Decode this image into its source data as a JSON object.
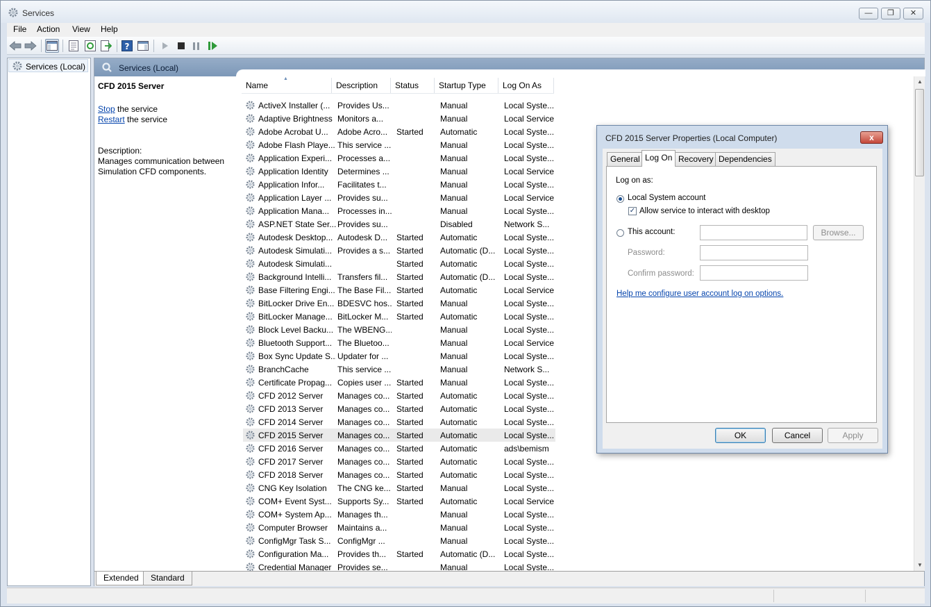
{
  "window": {
    "title": "Services"
  },
  "menu": [
    "File",
    "Action",
    "View",
    "Help"
  ],
  "tree": {
    "root_label": "Services (Local)"
  },
  "main": {
    "header": "Services (Local)",
    "selected_service": "CFD 2015 Server",
    "stop_link": "Stop",
    "stop_suffix": " the service",
    "restart_link": "Restart",
    "restart_suffix": " the service",
    "description_label": "Description:",
    "description_line1": "Manages communication between",
    "description_line2": "Simulation CFD components."
  },
  "columns": [
    "Name",
    "Description",
    "Status",
    "Startup Type",
    "Log On As"
  ],
  "rows": [
    [
      "ActiveX Installer (...",
      "Provides Us...",
      "",
      "Manual",
      "Local Syste..."
    ],
    [
      "Adaptive Brightness",
      "Monitors a...",
      "",
      "Manual",
      "Local Service"
    ],
    [
      "Adobe Acrobat U...",
      "Adobe Acro...",
      "Started",
      "Automatic",
      "Local Syste..."
    ],
    [
      "Adobe Flash Playe...",
      "This service ...",
      "",
      "Manual",
      "Local Syste..."
    ],
    [
      "Application Experi...",
      "Processes a...",
      "",
      "Manual",
      "Local Syste..."
    ],
    [
      "Application Identity",
      "Determines ...",
      "",
      "Manual",
      "Local Service"
    ],
    [
      "Application Infor...",
      "Facilitates t...",
      "",
      "Manual",
      "Local Syste..."
    ],
    [
      "Application Layer ...",
      "Provides su...",
      "",
      "Manual",
      "Local Service"
    ],
    [
      "Application Mana...",
      "Processes in...",
      "",
      "Manual",
      "Local Syste..."
    ],
    [
      "ASP.NET State Ser...",
      "Provides su...",
      "",
      "Disabled",
      "Network S..."
    ],
    [
      "Autodesk Desktop...",
      "Autodesk D...",
      "Started",
      "Automatic",
      "Local Syste..."
    ],
    [
      "Autodesk Simulati...",
      "Provides a s...",
      "Started",
      "Automatic (D...",
      "Local Syste..."
    ],
    [
      "Autodesk Simulati...",
      "",
      "Started",
      "Automatic",
      "Local Syste..."
    ],
    [
      "Background Intelli...",
      "Transfers fil...",
      "Started",
      "Automatic (D...",
      "Local Syste..."
    ],
    [
      "Base Filtering Engi...",
      "The Base Fil...",
      "Started",
      "Automatic",
      "Local Service"
    ],
    [
      "BitLocker Drive En...",
      "BDESVC hos...",
      "Started",
      "Manual",
      "Local Syste..."
    ],
    [
      "BitLocker Manage...",
      "BitLocker M...",
      "Started",
      "Automatic",
      "Local Syste..."
    ],
    [
      "Block Level Backu...",
      "The WBENG...",
      "",
      "Manual",
      "Local Syste..."
    ],
    [
      "Bluetooth Support...",
      "The Bluetoo...",
      "",
      "Manual",
      "Local Service"
    ],
    [
      "Box Sync Update S...",
      "Updater for ...",
      "",
      "Manual",
      "Local Syste..."
    ],
    [
      "BranchCache",
      "This service ...",
      "",
      "Manual",
      "Network S..."
    ],
    [
      "Certificate Propag...",
      "Copies user ...",
      "Started",
      "Manual",
      "Local Syste..."
    ],
    [
      "CFD 2012 Server",
      "Manages co...",
      "Started",
      "Automatic",
      "Local Syste..."
    ],
    [
      "CFD 2013 Server",
      "Manages co...",
      "Started",
      "Automatic",
      "Local Syste..."
    ],
    [
      "CFD 2014 Server",
      "Manages co...",
      "Started",
      "Automatic",
      "Local Syste..."
    ],
    [
      "CFD 2015 Server",
      "Manages co...",
      "Started",
      "Automatic",
      "Local Syste..."
    ],
    [
      "CFD 2016 Server",
      "Manages co...",
      "Started",
      "Automatic",
      "ads\\bemism"
    ],
    [
      "CFD 2017 Server",
      "Manages co...",
      "Started",
      "Automatic",
      "Local Syste..."
    ],
    [
      "CFD 2018 Server",
      "Manages co...",
      "Started",
      "Automatic",
      "Local Syste..."
    ],
    [
      "CNG Key Isolation",
      "The CNG ke...",
      "Started",
      "Manual",
      "Local Syste..."
    ],
    [
      "COM+ Event Syst...",
      "Supports Sy...",
      "Started",
      "Automatic",
      "Local Service"
    ],
    [
      "COM+ System Ap...",
      "Manages th...",
      "",
      "Manual",
      "Local Syste..."
    ],
    [
      "Computer Browser",
      "Maintains a...",
      "",
      "Manual",
      "Local Syste..."
    ],
    [
      "ConfigMgr Task S...",
      "ConfigMgr ...",
      "",
      "Manual",
      "Local Syste..."
    ],
    [
      "Configuration Ma...",
      "Provides th...",
      "Started",
      "Automatic (D...",
      "Local Syste..."
    ],
    [
      "Credential Manager",
      "Provides se...",
      "",
      "Manual",
      "Local Syste..."
    ]
  ],
  "bottom_tabs": [
    "Extended",
    "Standard"
  ],
  "dialog": {
    "title": "CFD 2015 Server Properties (Local Computer)",
    "close_label": "x",
    "tabs": [
      "General",
      "Log On",
      "Recovery",
      "Dependencies"
    ],
    "logon_as": "Log on as:",
    "local_system": "Local System account",
    "allow_interact": "Allow service to interact with desktop",
    "this_account": "This account:",
    "browse": "Browse...",
    "password": "Password:",
    "confirm_password": "Confirm password:",
    "help_link": "Help me configure user account log on options.",
    "ok": "OK",
    "cancel": "Cancel",
    "apply": "Apply"
  },
  "colors": {
    "header_blue": "#7d98b8",
    "link": "#0645ad",
    "close_red": "#c4483a"
  }
}
